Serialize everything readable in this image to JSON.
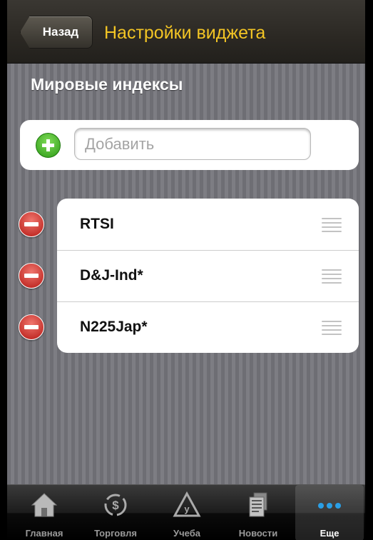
{
  "header": {
    "back_label": "Назад",
    "title": "Настройки виджета"
  },
  "section": {
    "title": "Мировые индексы"
  },
  "add": {
    "placeholder": "Добавить"
  },
  "list": {
    "items": [
      {
        "label": "RTSI"
      },
      {
        "label": "D&J-Ind*"
      },
      {
        "label": "N225Jap*"
      }
    ]
  },
  "tabbar": {
    "tabs": [
      {
        "label": "Главная",
        "icon": "home-icon"
      },
      {
        "label": "Торговля",
        "icon": "dollar-cycle-icon"
      },
      {
        "label": "Учеба",
        "icon": "study-triangle-icon"
      },
      {
        "label": "Новости",
        "icon": "newspaper-icon"
      },
      {
        "label": "Еще",
        "icon": "more-dots-icon"
      }
    ],
    "active_index": 4
  },
  "colors": {
    "title_accent": "#f3c524",
    "add_green": "#2d9a17",
    "delete_red": "#b41813",
    "more_dots_blue": "#2a9fe6"
  }
}
